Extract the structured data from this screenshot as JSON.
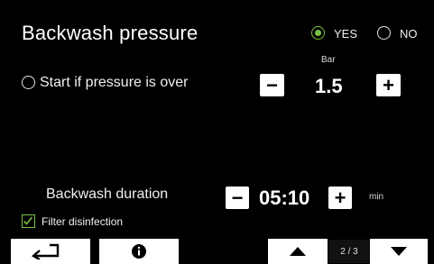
{
  "header": {
    "title": "Backwash pressure"
  },
  "enable": {
    "yes_label": "YES",
    "no_label": "NO",
    "selected": "YES"
  },
  "pressure": {
    "start_label": "Start if pressure is over",
    "unit": "Bar",
    "value": "1.5",
    "decrement_symbol": "−",
    "increment_symbol": "+"
  },
  "duration": {
    "label": "Backwash duration",
    "value": "05:10",
    "unit": "min",
    "decrement_symbol": "−",
    "increment_symbol": "+"
  },
  "filter_disinfection": {
    "label": "Filter disinfection",
    "checked": true
  },
  "footer": {
    "back_icon": "return-arrow-icon",
    "info_icon": "info-icon",
    "up_icon": "triangle-up-icon",
    "down_icon": "triangle-down-icon",
    "page_indicator": "2 / 3"
  },
  "colors": {
    "accent": "#7bc043",
    "background": "#000000",
    "button": "#ffffff"
  }
}
